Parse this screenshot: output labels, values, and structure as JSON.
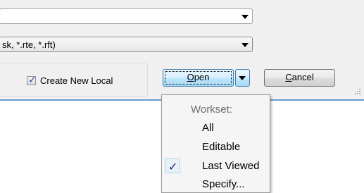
{
  "combo_top": {
    "value": ""
  },
  "file_type": {
    "value": "sk, *.rte, *.rft)"
  },
  "create_new_local": {
    "label": "Create New Local",
    "checked": true
  },
  "open_button": {
    "label_underlined": "O",
    "label_rest": "pen"
  },
  "cancel_button": {
    "label_underlined": "C",
    "label_rest": "ancel"
  },
  "menu": {
    "header": "Workset:",
    "items": [
      {
        "label": "All",
        "checked": false
      },
      {
        "label": "Editable",
        "checked": false
      },
      {
        "label": "Last Viewed",
        "checked": true
      },
      {
        "label": "Specify...",
        "checked": false
      }
    ]
  },
  "colors": {
    "accent": "#3c7fb1",
    "dialog_bg": "#f0f0f0",
    "border_blue": "#6b9ad1",
    "check_color": "#1a1a8c"
  },
  "icons": [
    "dropdown-arrow-icon",
    "checkmark-icon",
    "resize-grip-icon"
  ]
}
